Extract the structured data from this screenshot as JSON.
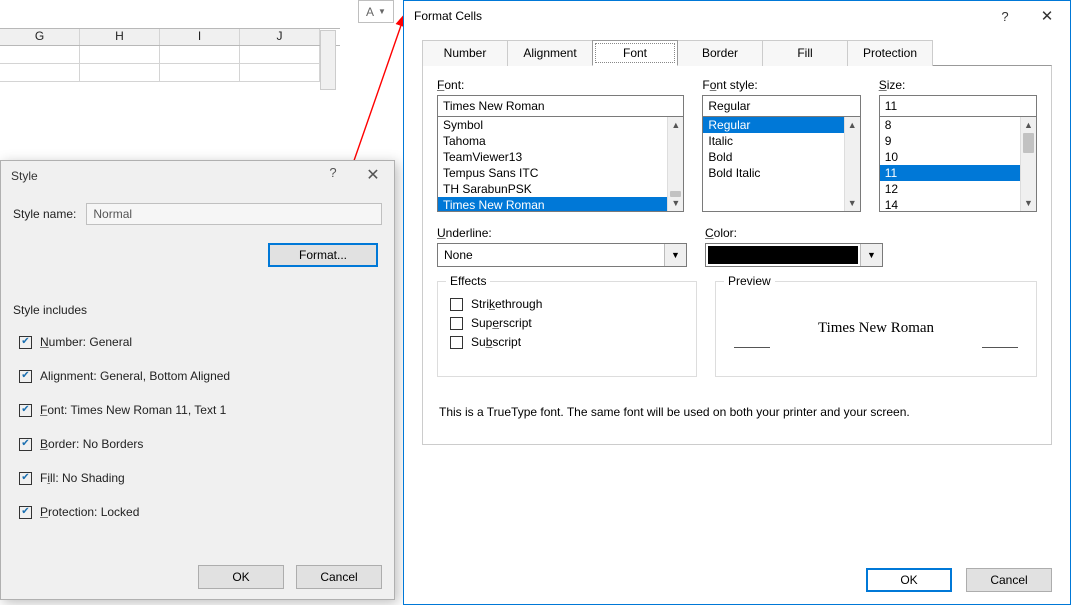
{
  "sheet": {
    "cols": [
      "G",
      "H",
      "I",
      "J"
    ]
  },
  "nameBox": {
    "value": "A"
  },
  "styleDlg": {
    "title": "Style",
    "styleNameLabel": "Style name:",
    "styleNameValue": "Normal",
    "formatBtn": "Format...",
    "includesLabel": "Style includes",
    "opts": {
      "number": "Number: General",
      "alignment": "Alignment: General, Bottom Aligned",
      "font": "Font: Times New Roman 11, Text 1",
      "border": "Border: No Borders",
      "fill": "Fill: No Shading",
      "protection": "Protection: Locked"
    },
    "ok": "OK",
    "cancel": "Cancel"
  },
  "fc": {
    "title": "Format Cells",
    "tabs": {
      "number": "Number",
      "alignment": "Alignment",
      "font": "Font",
      "border": "Border",
      "fill": "Fill",
      "protection": "Protection"
    },
    "fontLabel": "Font:",
    "fontValue": "Times New Roman",
    "fontList": [
      "Symbol",
      "Tahoma",
      "TeamViewer13",
      "Tempus Sans ITC",
      "TH SarabunPSK",
      "Times New Roman"
    ],
    "styleLabel": "Font style:",
    "styleValue": "Regular",
    "styleList": [
      "Regular",
      "Italic",
      "Bold",
      "Bold Italic"
    ],
    "sizeLabel": "Size:",
    "sizeValue": "11",
    "sizeList": [
      "8",
      "9",
      "10",
      "11",
      "12",
      "14"
    ],
    "underlineLabel": "Underline:",
    "underlineValue": "None",
    "colorLabel": "Color:",
    "effectsLabel": "Effects",
    "fx": {
      "strike": "Strikethrough",
      "sup": "Superscript",
      "sub": "Subscript"
    },
    "previewLabel": "Preview",
    "previewText": "Times New Roman",
    "desc": "This is a TrueType font.  The same font will be used on both your printer and your screen.",
    "ok": "OK",
    "cancel": "Cancel"
  }
}
